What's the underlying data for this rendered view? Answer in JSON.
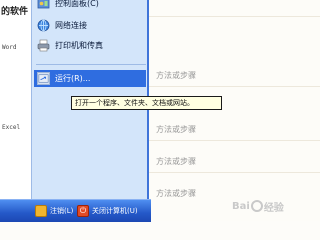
{
  "left_panel": {
    "header_partial": "的软件",
    "word_partial": "Word",
    "excel_partial": "Excel"
  },
  "start_menu": {
    "items": [
      {
        "label": "控制面板(C)",
        "icon": "control-panel-icon"
      },
      {
        "label": "网络连接",
        "icon": "network-connections-icon"
      },
      {
        "label": "打印机和传真",
        "icon": "printers-faxes-icon"
      },
      {
        "label": "运行(R)...",
        "icon": "run-icon"
      }
    ]
  },
  "content": {
    "steps": [
      "方法或步骤",
      "方法或步骤",
      "方法或步骤",
      "方法或步骤"
    ]
  },
  "tooltip": {
    "text": "打开一个程序、文件夹、文档或网站。"
  },
  "taskbar": {
    "logoff_label": "注销(L)",
    "shutdown_label": "关闭计算机(U)"
  },
  "watermark": {
    "text_left": "Bai",
    "text_right": "经验"
  },
  "colors": {
    "menu_blue": "#d3e5fa",
    "highlight": "#2f6de0",
    "taskbar": "#2458c8",
    "tooltip_bg": "#ffffe1"
  }
}
